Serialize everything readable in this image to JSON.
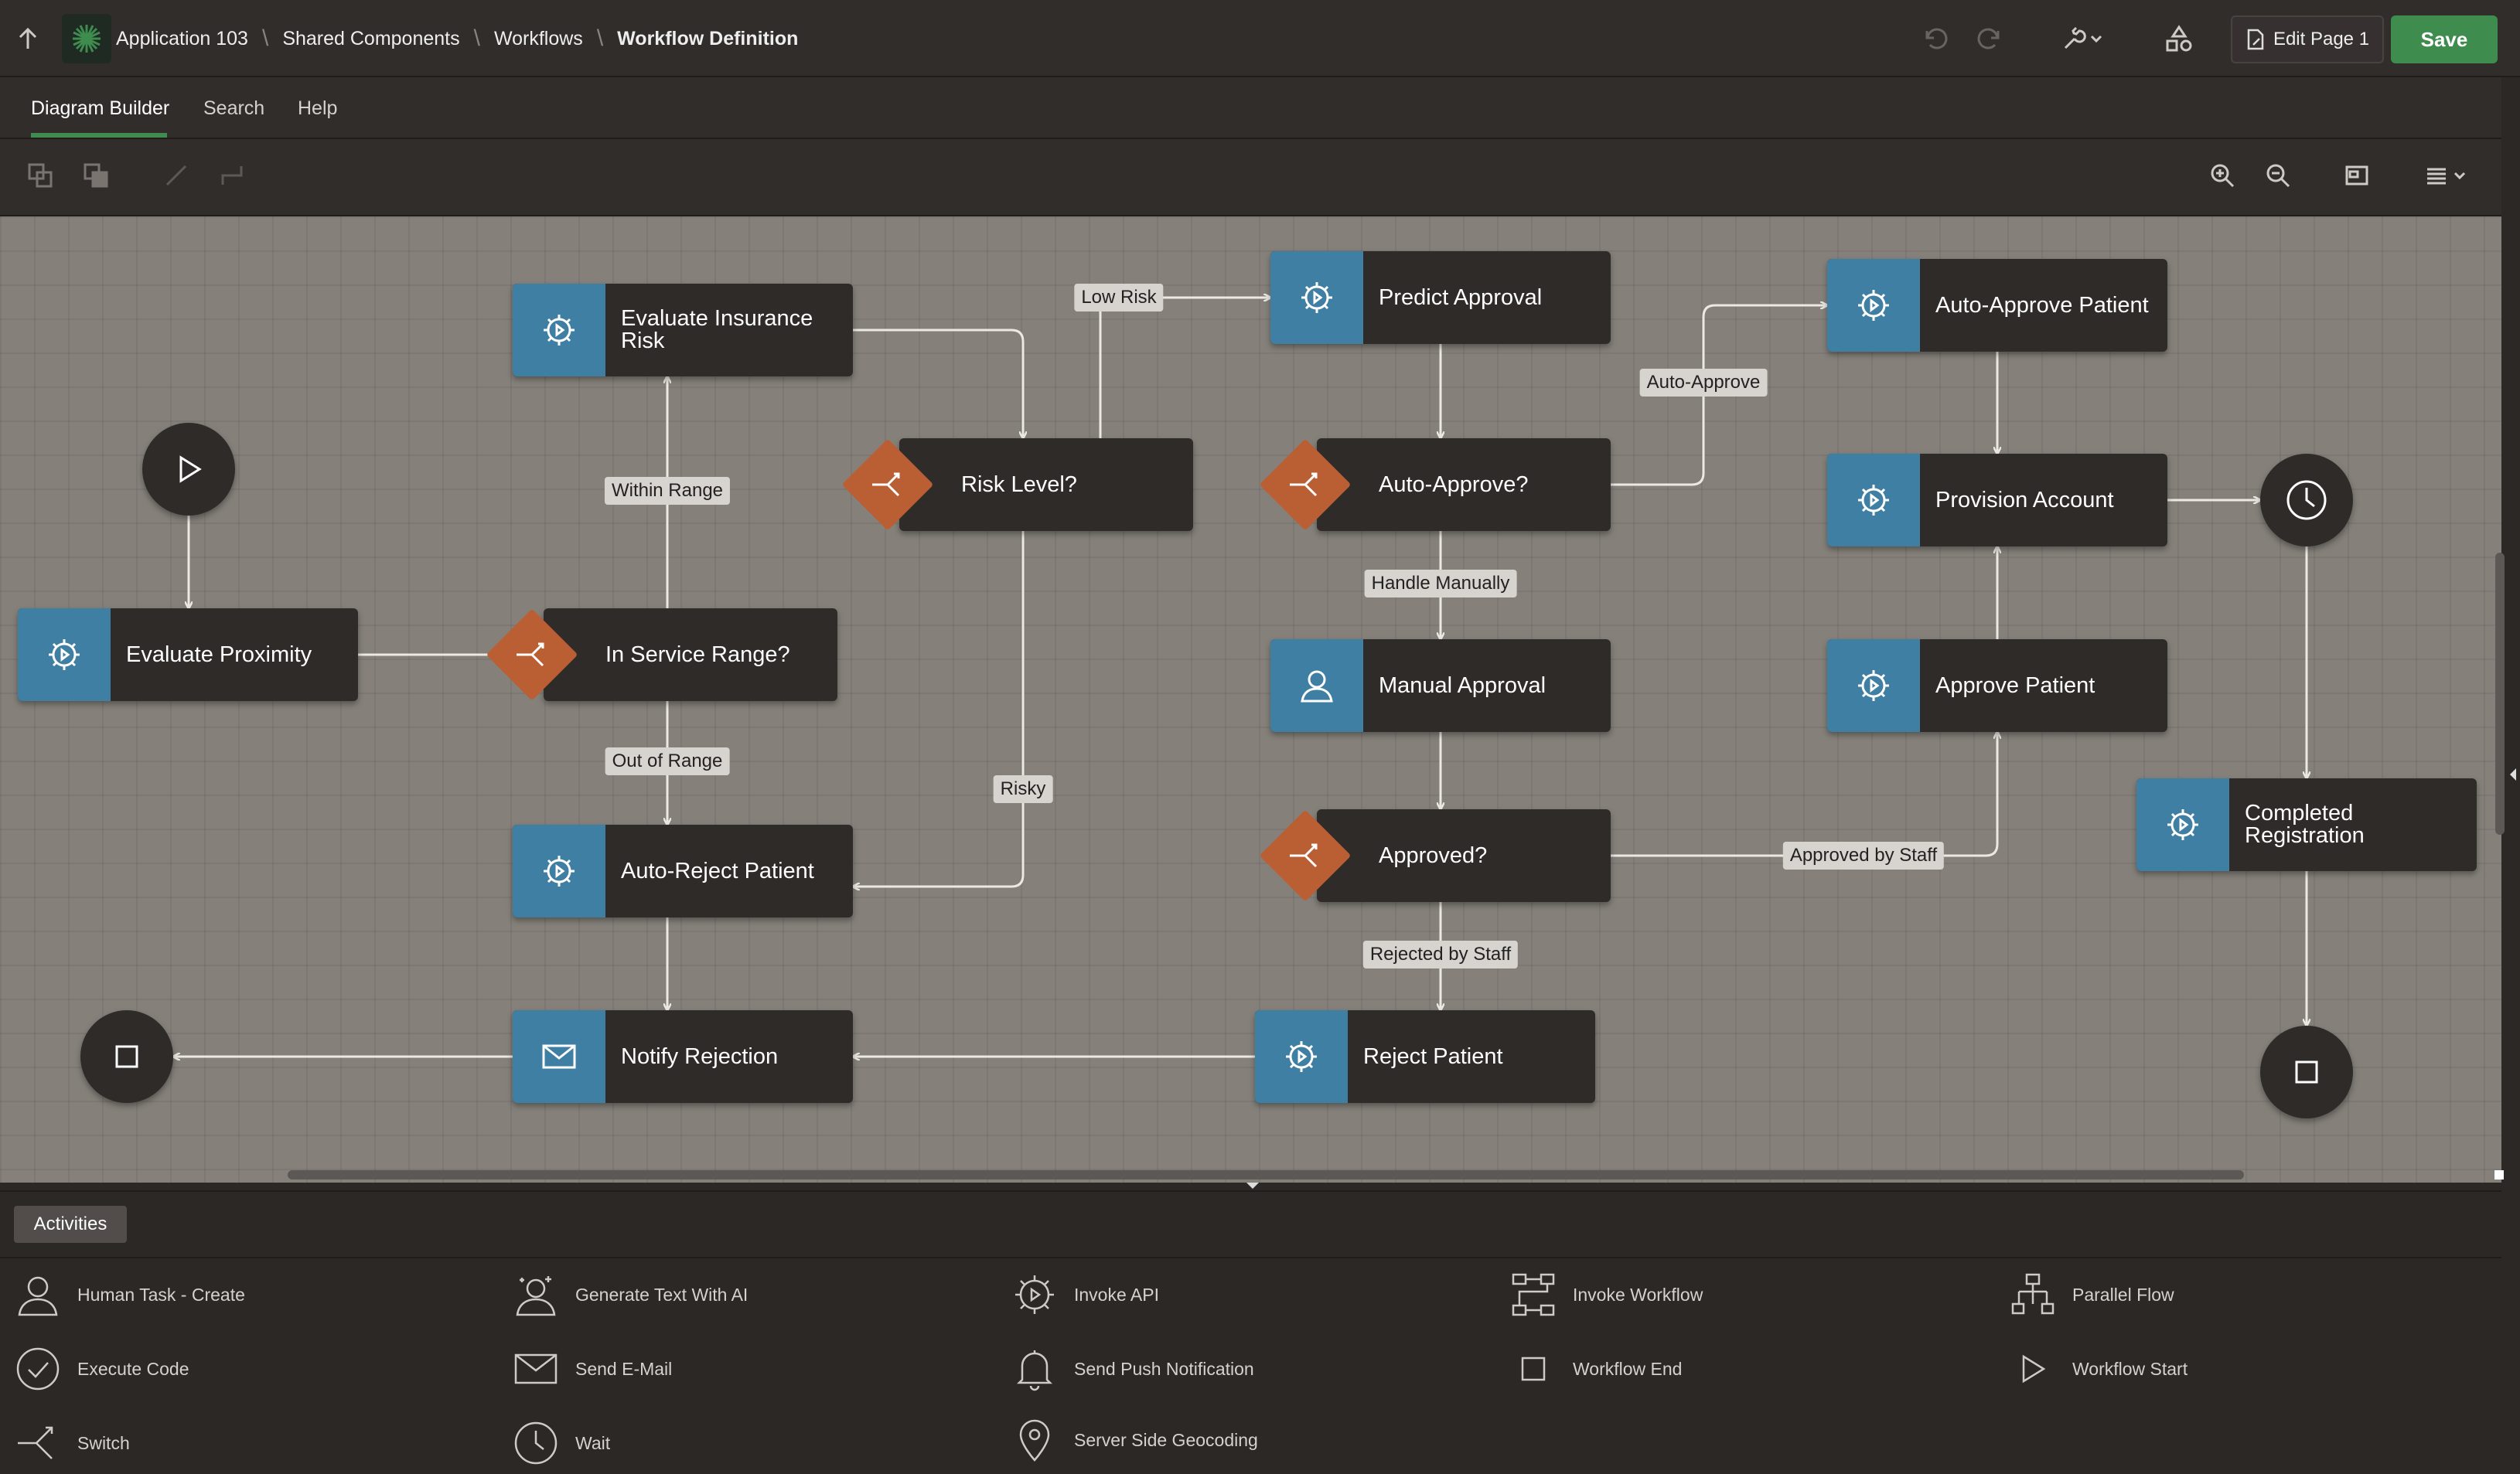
{
  "breadcrumb": {
    "items": [
      "Application 103",
      "Shared Components",
      "Workflows",
      "Workflow Definition"
    ]
  },
  "header": {
    "edit_page_label": "Edit Page 1",
    "save_label": "Save"
  },
  "tabs": [
    {
      "label": "Diagram Builder",
      "active": true
    },
    {
      "label": "Search"
    },
    {
      "label": "Help"
    }
  ],
  "nodes": {
    "evaluate_insurance_risk": "Evaluate Insurance Risk",
    "evaluate_proximity": "Evaluate Proximity",
    "in_service_range": "In Service Range?",
    "risk_level": "Risk Level?",
    "auto_reject_patient": "Auto-Reject Patient",
    "notify_rejection": "Notify Rejection",
    "predict_approval": "Predict Approval",
    "auto_approve_decision": "Auto-Approve?",
    "manual_approval": "Manual Approval",
    "approved_decision": "Approved?",
    "reject_patient": "Reject Patient",
    "auto_approve_patient": "Auto-Approve Patient",
    "provision_account": "Provision Account",
    "approve_patient": "Approve Patient",
    "completed_registration": "Completed Registration"
  },
  "edge_labels": {
    "within_range": "Within Range",
    "out_of_range": "Out of Range",
    "low_risk": "Low Risk",
    "risky": "Risky",
    "auto_approve": "Auto-Approve",
    "handle_manually": "Handle Manually",
    "rejected_by_staff": "Rejected by Staff",
    "approved_by_staff": "Approved by Staff"
  },
  "palette": {
    "tab_label": "Activities",
    "items": [
      {
        "label": "Human Task - Create",
        "icon": "person-icon"
      },
      {
        "label": "Generate Text With AI",
        "icon": "ai-person-icon"
      },
      {
        "label": "Invoke API",
        "icon": "gear-play-icon"
      },
      {
        "label": "Invoke Workflow",
        "icon": "workflow-icon"
      },
      {
        "label": "Parallel Flow",
        "icon": "parallel-flow-icon"
      },
      {
        "label": "Execute Code",
        "icon": "check-circle-icon"
      },
      {
        "label": "Send E-Mail",
        "icon": "envelope-icon"
      },
      {
        "label": "Send Push Notification",
        "icon": "bell-icon"
      },
      {
        "label": "Workflow End",
        "icon": "square-icon"
      },
      {
        "label": "Workflow Start",
        "icon": "play-icon"
      },
      {
        "label": "Switch",
        "icon": "switch-icon"
      },
      {
        "label": "Wait",
        "icon": "clock-icon"
      },
      {
        "label": "Server Side Geocoding",
        "icon": "map-pin-icon"
      }
    ]
  },
  "colors": {
    "accent": "#3f8c4f",
    "task": "#3f7fa3",
    "switch": "#b95f33",
    "canvas": "#85807a"
  }
}
